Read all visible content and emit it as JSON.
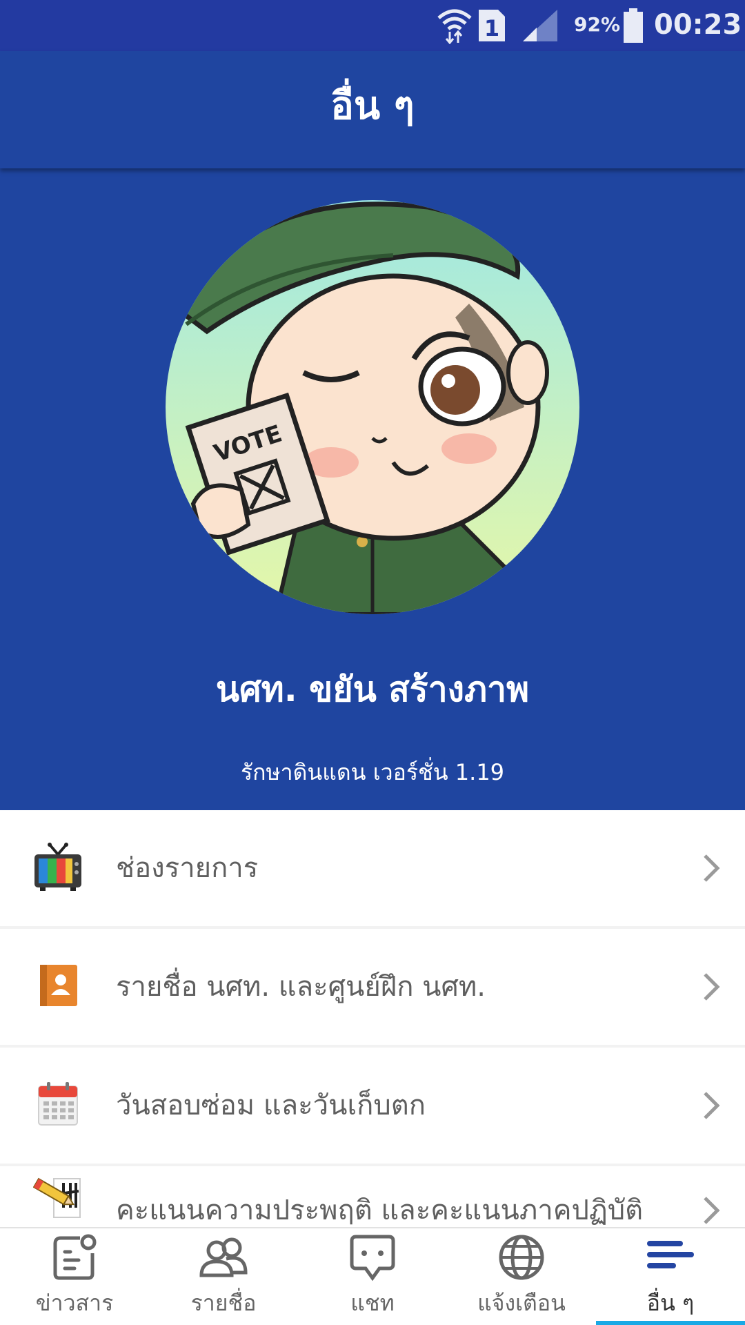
{
  "status_bar": {
    "sim_slot": "1",
    "battery_percent": "92%",
    "time": "00:23"
  },
  "app_bar": {
    "title": "อื่น ๆ"
  },
  "profile": {
    "avatar_card_text": "VOTE",
    "name": "นศท. ขยัน สร้างภาพ",
    "version_text": "รักษาดินแดน เวอร์ชั่น 1.19"
  },
  "menu": {
    "items": [
      {
        "label": "ช่องรายการ",
        "icon": "tv-icon"
      },
      {
        "label": "รายชื่อ นศท. และศูนย์ฝึก นศท.",
        "icon": "contacts-book-icon"
      },
      {
        "label": "วันสอบซ่อม และวันเก็บตก",
        "icon": "calendar-icon"
      },
      {
        "label": "คะแนนความประพฤติ และคะแนนภาคปฏิบัติ",
        "icon": "pencil-score-icon"
      }
    ]
  },
  "bottom_nav": {
    "items": [
      {
        "label": "ข่าวสาร",
        "icon": "news-icon"
      },
      {
        "label": "รายชื่อ",
        "icon": "people-icon"
      },
      {
        "label": "แชท",
        "icon": "chat-icon"
      },
      {
        "label": "แจ้งเตือน",
        "icon": "globe-icon"
      },
      {
        "label": "อื่น ๆ",
        "icon": "menu-lines-icon"
      }
    ],
    "active_index": 4
  },
  "colors": {
    "primary": "#1f45a0",
    "status_bar": "#233aa1",
    "active_indicator": "#19a9e5",
    "nav_active": "#2445a2"
  }
}
